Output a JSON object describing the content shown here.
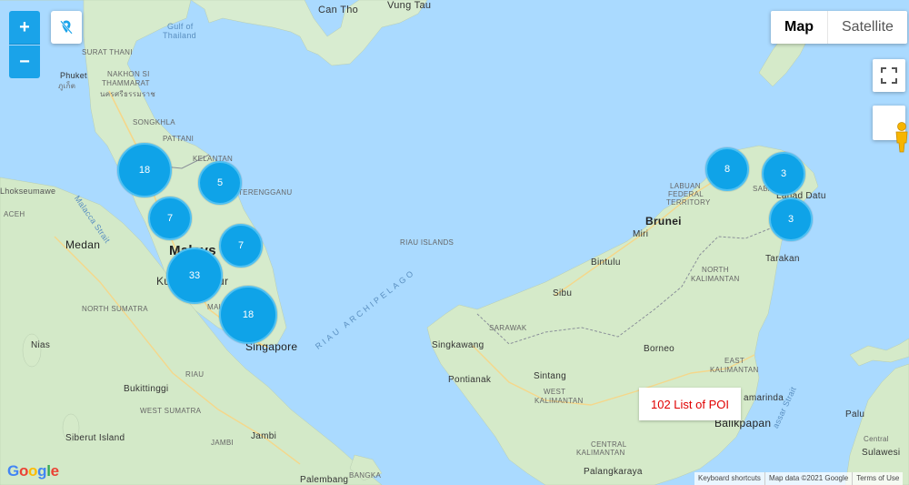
{
  "controls": {
    "zoom_in": "+",
    "zoom_out": "−",
    "locate_icon": "location-off-icon",
    "map_type": [
      "Map",
      "Satellite"
    ],
    "active_map_type": "Map",
    "fullscreen_icon": "fullscreen-icon",
    "street_view_icon": "pegman-icon"
  },
  "clusters": [
    {
      "count": "18"
    },
    {
      "count": "5"
    },
    {
      "count": "7"
    },
    {
      "count": "7"
    },
    {
      "count": "33"
    },
    {
      "count": "18"
    },
    {
      "count": "8"
    },
    {
      "count": "3"
    },
    {
      "count": "3"
    }
  ],
  "labels": {
    "gulf": "Gulf of",
    "thailand": "Thailand",
    "can_tho": "Can Tho",
    "vung_tau": "Vung Tau",
    "surat_thani": "SURAT THANI",
    "phuket": "Phuket",
    "phuket_thai": "ภูเก็ต",
    "nakhon": "NAKHON SI",
    "thammarat": "THAMMARAT",
    "nakhon_thai": "นครศรีธรรมราช",
    "songkhla": "SONGKHLA",
    "pattani": "PATTANI",
    "kelantan": "KELANTAN",
    "terengganu": "TERENGGANU",
    "lhokseumawe": "Lhokseumawe",
    "aceh": "ACEH",
    "malacca_strait": "Malacca Strait",
    "medan": "Medan",
    "malaysia": "Malays",
    "kuala_lumpur": "Ku",
    "lumpur_tail": "ur",
    "malacca": "MALAC",
    "north_sumatra": "NORTH SUMATRA",
    "singapore": "Singapore",
    "riau_islands": "RIAU ISLANDS",
    "riau_archipelago": "RIAU ARCHIPELAGO",
    "nias": "Nias",
    "riau": "RIAU",
    "bukittinggi": "Bukittinggi",
    "west_sumatra": "WEST SUMATRA",
    "jambi_region": "JAMBI",
    "siberut": "Siberut Island",
    "jambi": "Jambi",
    "palembang": "Palembang",
    "bangka": "BANGKA",
    "brunei": "Brunei",
    "miri": "Miri",
    "labuan": "LABUAN",
    "federal_territory": "FEDERAL",
    "territory": "TERRITORY",
    "sabah": "SABAH",
    "lahad_datu": "Lahad Datu",
    "tarakan": "Tarakan",
    "bintulu": "Bintulu",
    "sibu": "Sibu",
    "sarawak": "SARAWAK",
    "north_kalimantan_1": "NORTH",
    "north_kalimantan_2": "KALIMANTAN",
    "singkawang": "Singkawang",
    "borneo": "Borneo",
    "east_kalimantan_1": "EAST",
    "east_kalimantan_2": "KALIMANTAN",
    "pontianak": "Pontianak",
    "sintang": "Sintang",
    "west_kalimantan_1": "WEST",
    "west_kalimantan_2": "KALIMANTAN",
    "samarinda": "amarinda",
    "balikpapan": "Balikpapan",
    "central_kalimantan_1": "CENTRAL",
    "central_kalimantan_2": "KALIMANTAN",
    "palangkaraya": "Palangkaraya",
    "makassar_strait": "assar Strait",
    "palu": "Palu",
    "sulawesi": "Sulawesi",
    "central": "Central"
  },
  "poi_box": "102 List of POI",
  "footer": {
    "shortcuts": "Keyboard shortcuts",
    "map_data": "Map data ©2021 Google",
    "terms": "Terms of Use"
  },
  "logo": "Google"
}
